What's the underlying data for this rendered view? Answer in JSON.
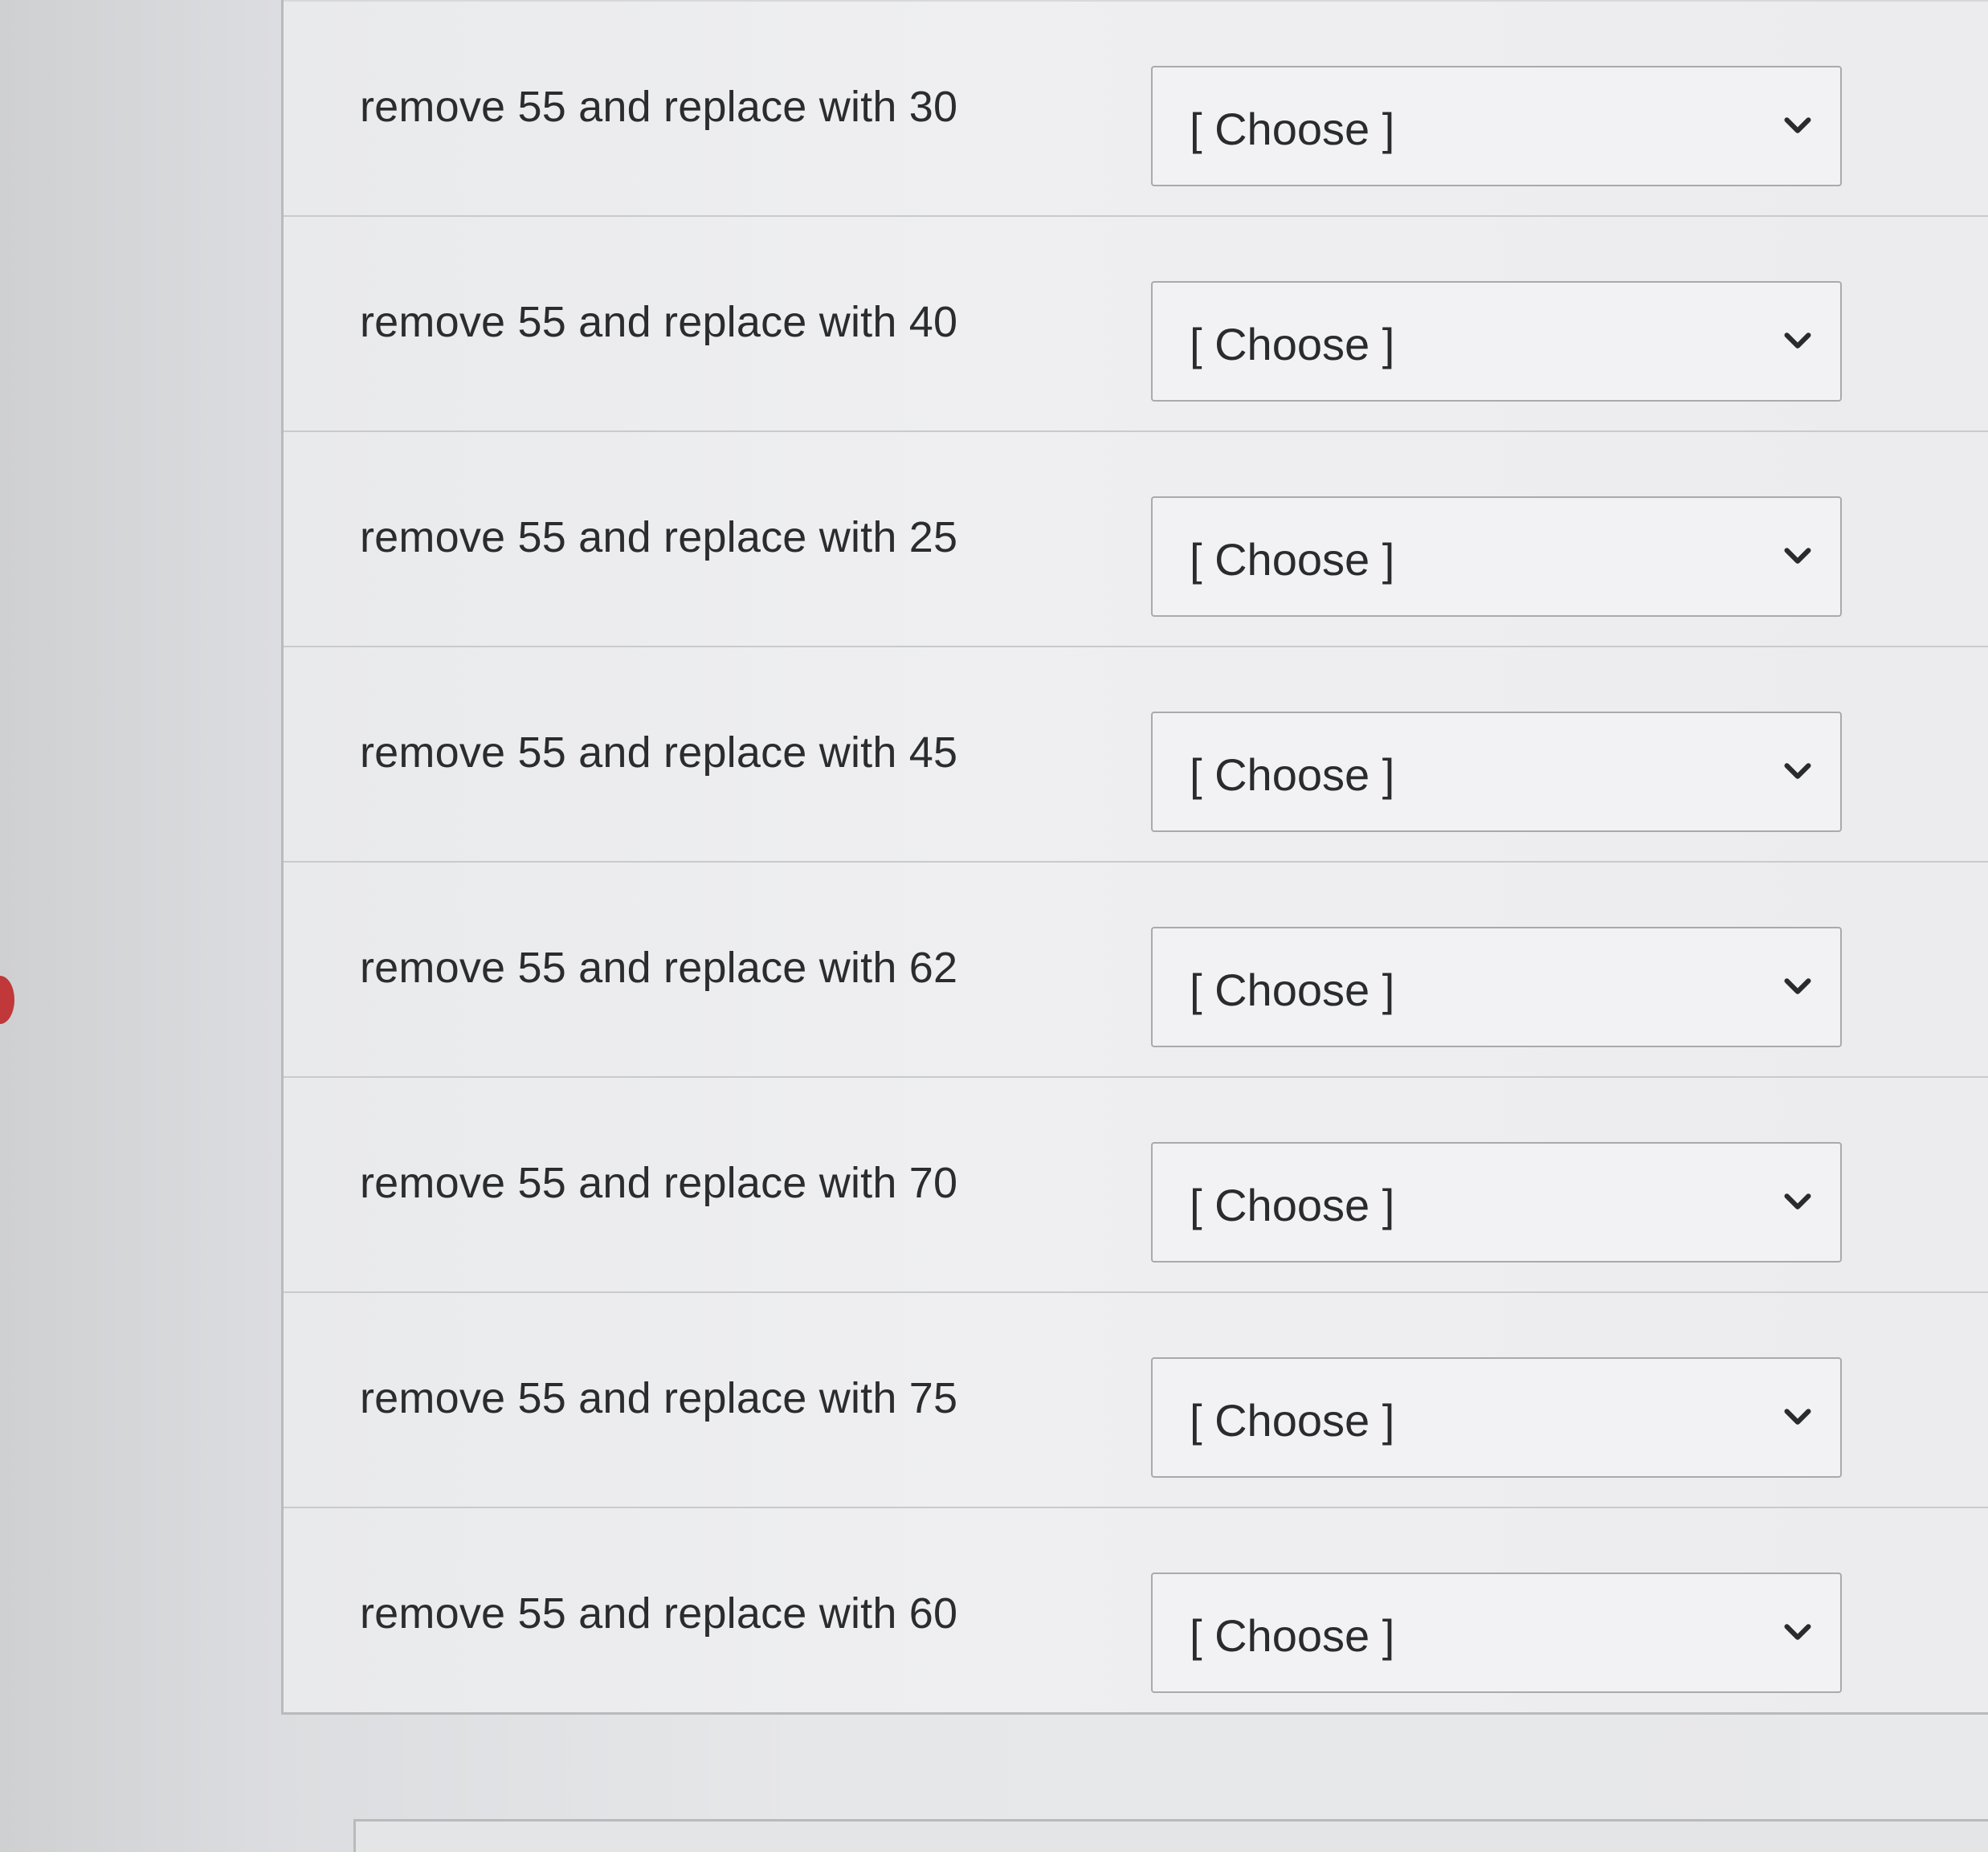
{
  "rows": [
    {
      "label": "remove 55 and replace with 30",
      "selected": "[ Choose ]"
    },
    {
      "label": "remove 55 and replace with 40",
      "selected": "[ Choose ]"
    },
    {
      "label": "remove 55 and replace with 25",
      "selected": "[ Choose ]"
    },
    {
      "label": "remove 55 and replace with 45",
      "selected": "[ Choose ]"
    },
    {
      "label": "remove 55 and replace with 62",
      "selected": "[ Choose ]"
    },
    {
      "label": "remove 55 and replace with 70",
      "selected": "[ Choose ]"
    },
    {
      "label": "remove 55 and replace with 75",
      "selected": "[ Choose ]"
    },
    {
      "label": "remove 55 and replace with 60",
      "selected": "[ Choose ]"
    }
  ],
  "icons": {
    "dropdown": "chevron-down-icon"
  },
  "colors": {
    "text": "#2b2c2e",
    "border": "#a9aaac",
    "background": "#e8e9eb"
  }
}
